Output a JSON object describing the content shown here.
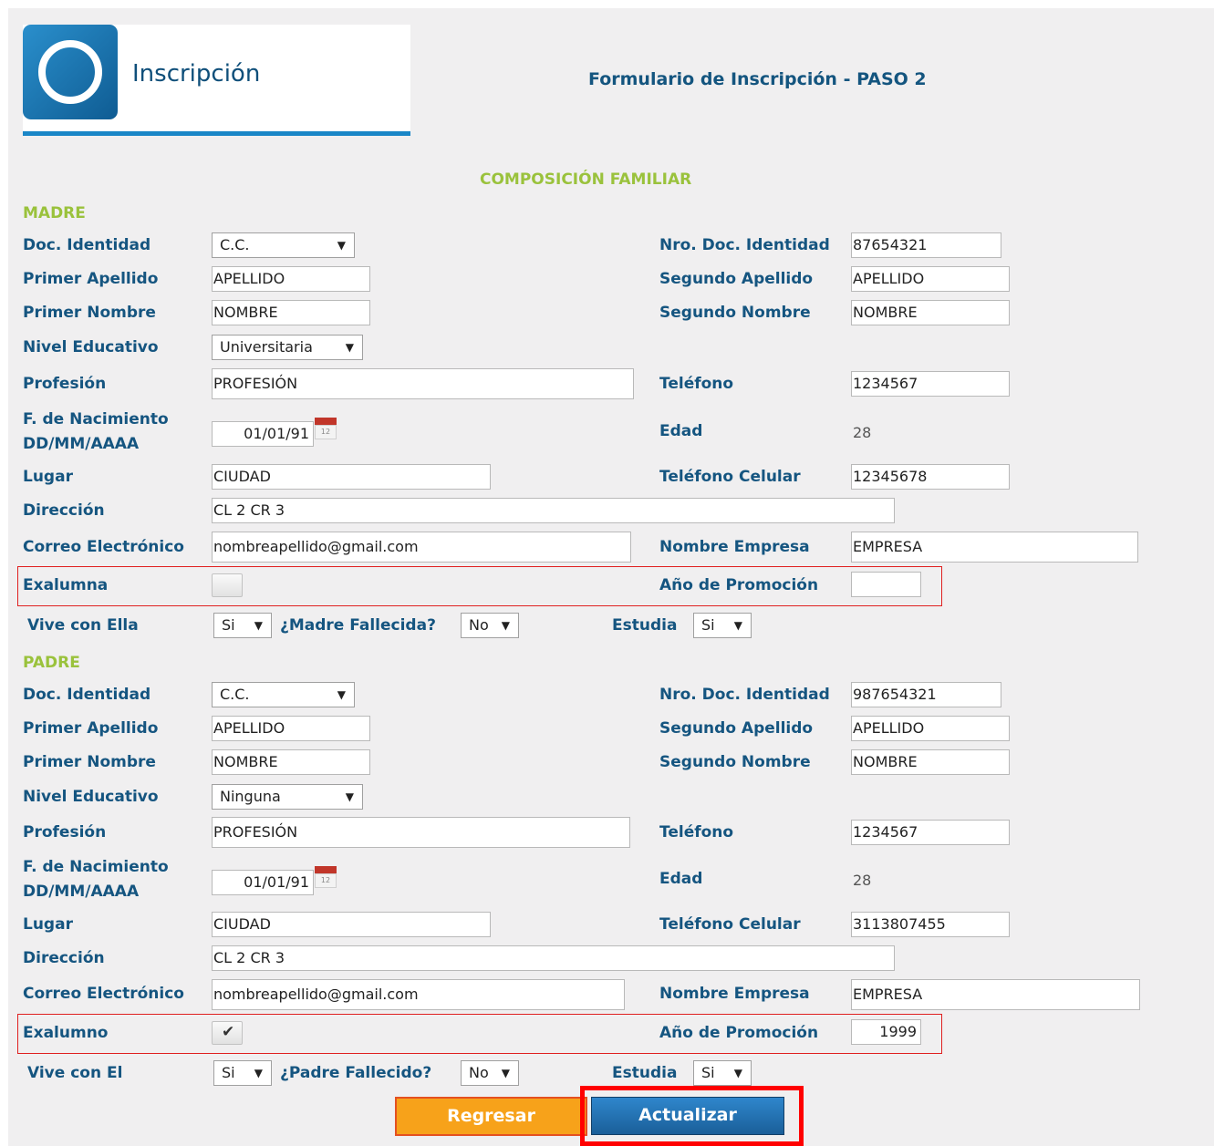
{
  "header": {
    "app_title": "Inscripción",
    "form_title": "Formulario de Inscripción - PASO 2",
    "logo_icon": "ring-logo-icon"
  },
  "section_title": "COMPOSICIÓN FAMILIAR",
  "madre": {
    "heading": "MADRE",
    "doc_identidad_label": "Doc. Identidad",
    "doc_identidad_value": "C.C.",
    "nro_doc_label": "Nro. Doc. Identidad",
    "nro_doc_value": "87654321",
    "primer_apellido_label": "Primer Apellido",
    "primer_apellido_value": "APELLIDO",
    "segundo_apellido_label": "Segundo Apellido",
    "segundo_apellido_value": "APELLIDO",
    "primer_nombre_label": "Primer Nombre",
    "primer_nombre_value": "NOMBRE",
    "segundo_nombre_label": "Segundo Nombre",
    "segundo_nombre_value": "NOMBRE",
    "nivel_educativo_label": "Nivel Educativo",
    "nivel_educativo_value": "Universitaria",
    "profesion_label": "Profesión",
    "profesion_value": "PROFESIÓN",
    "telefono_label": "Teléfono",
    "telefono_value": "1234567",
    "fnac_label_1": "F. de Nacimiento",
    "fnac_label_2": "DD/MM/AAAA",
    "fnac_value": "01/01/91",
    "edad_label": "Edad",
    "edad_value": "28",
    "lugar_label": "Lugar",
    "lugar_value": "CIUDAD",
    "celular_label": "Teléfono Celular",
    "celular_value": "12345678",
    "direccion_label": "Dirección",
    "direccion_value": "CL 2 CR 3",
    "correo_label": "Correo Electrónico",
    "correo_value": "nombreapellido@gmail.com",
    "empresa_label": "Nombre Empresa",
    "empresa_value": "EMPRESA",
    "exalumno_label": "Exalumna",
    "exalumno_checked": false,
    "promocion_label": "Año de Promoción",
    "promocion_value": "",
    "vive_label": "Vive con Ella",
    "vive_value": "Si",
    "fallecido_label": "¿Madre Fallecida?",
    "fallecido_value": "No",
    "estudia_label": "Estudia",
    "estudia_value": "Si"
  },
  "padre": {
    "heading": "PADRE",
    "doc_identidad_label": "Doc. Identidad",
    "doc_identidad_value": "C.C.",
    "nro_doc_label": "Nro. Doc. Identidad",
    "nro_doc_value": "987654321",
    "primer_apellido_label": "Primer Apellido",
    "primer_apellido_value": "APELLIDO",
    "segundo_apellido_label": "Segundo Apellido",
    "segundo_apellido_value": "APELLIDO",
    "primer_nombre_label": "Primer Nombre",
    "primer_nombre_value": "NOMBRE",
    "segundo_nombre_label": "Segundo Nombre",
    "segundo_nombre_value": "NOMBRE",
    "nivel_educativo_label": "Nivel Educativo",
    "nivel_educativo_value": "Ninguna",
    "profesion_label": "Profesión",
    "profesion_value": "PROFESIÓN",
    "telefono_label": "Teléfono",
    "telefono_value": "1234567",
    "fnac_label_1": "F. de Nacimiento",
    "fnac_label_2": "DD/MM/AAAA",
    "fnac_value": "01/01/91",
    "edad_label": "Edad",
    "edad_value": "28",
    "lugar_label": "Lugar",
    "lugar_value": "CIUDAD",
    "celular_label": "Teléfono Celular",
    "celular_value": "3113807455",
    "direccion_label": "Dirección",
    "direccion_value": "CL 2 CR 3",
    "correo_label": "Correo Electrónico",
    "correo_value": "nombreapellido@gmail.com",
    "empresa_label": "Nombre Empresa",
    "empresa_value": "EMPRESA",
    "exalumno_label": "Exalumno",
    "exalumno_checked": true,
    "promocion_label": "Año de Promoción",
    "promocion_value": "1999",
    "vive_label": "Vive con El",
    "vive_value": "Si",
    "fallecido_label": "¿Padre Fallecido?",
    "fallecido_value": "No",
    "estudia_label": "Estudia",
    "estudia_value": "Si"
  },
  "buttons": {
    "back_label": "Regresar",
    "update_label": "Actualizar"
  },
  "icons": {
    "dropdown": "▼",
    "checkmark": "✔",
    "calendar_day": "12"
  },
  "colors": {
    "label": "#155580",
    "section_heading": "#9ac23c",
    "accent_blue": "#1a86c7",
    "back_button": "#f7a21a",
    "highlight": "#ff0000"
  }
}
